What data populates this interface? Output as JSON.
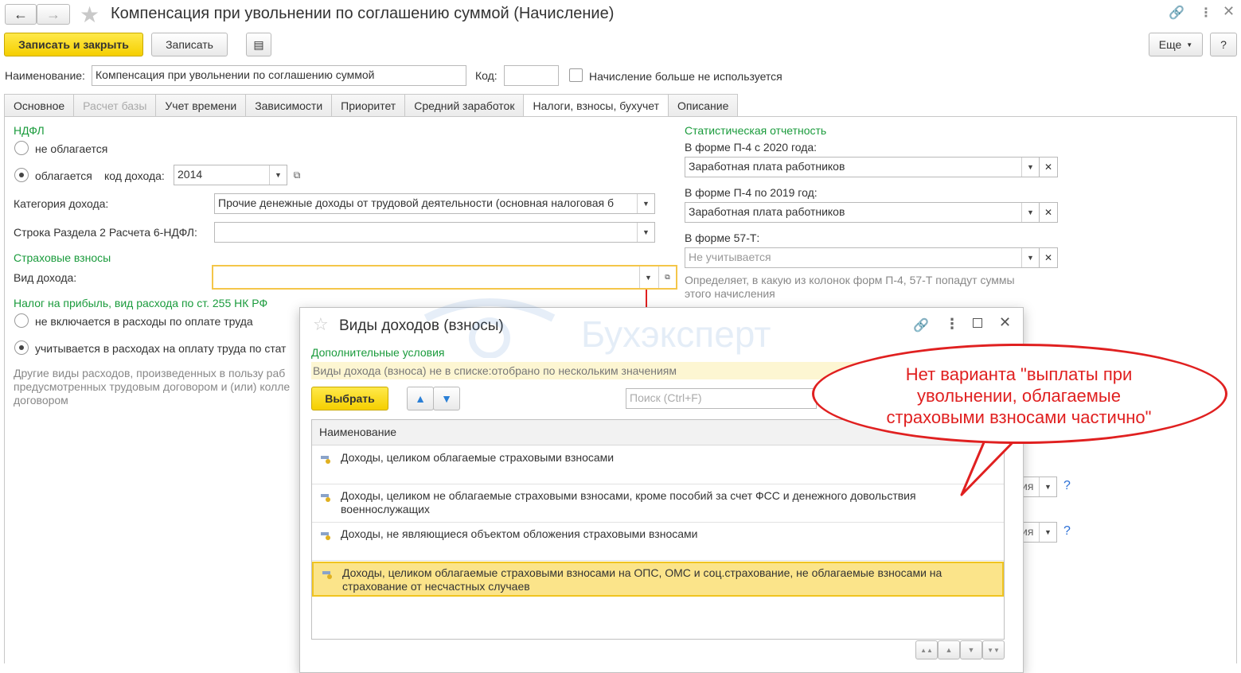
{
  "window": {
    "title": "Компенсация при увольнении по соглашению суммой (Начисление)"
  },
  "toolbar": {
    "save_close": "Записать и закрыть",
    "save": "Записать",
    "more": "Еще",
    "help": "?"
  },
  "form": {
    "name_label": "Наименование:",
    "name_value": "Компенсация при увольнении по соглашению суммой",
    "code_label": "Код:",
    "code_value": "",
    "unused_label": "Начисление больше не используется"
  },
  "tabs": [
    {
      "label": "Основное",
      "state": "normal"
    },
    {
      "label": "Расчет базы",
      "state": "disabled"
    },
    {
      "label": "Учет времени",
      "state": "normal"
    },
    {
      "label": "Зависимости",
      "state": "normal"
    },
    {
      "label": "Приоритет",
      "state": "normal"
    },
    {
      "label": "Средний заработок",
      "state": "normal"
    },
    {
      "label": "Налоги, взносы, бухучет",
      "state": "active"
    },
    {
      "label": "Описание",
      "state": "normal"
    }
  ],
  "ndfl": {
    "section": "НДФЛ",
    "not_taxed": "не облагается",
    "taxed": "облагается",
    "income_code_label": "код дохода:",
    "income_code_value": "2014",
    "income_category_label": "Категория дохода:",
    "income_category_value": "Прочие денежные доходы от трудовой деятельности (основная налоговая б",
    "row_6ndfl_label": "Строка Раздела 2 Расчета 6-НДФЛ:",
    "row_6ndfl_value": ""
  },
  "insurance": {
    "section": "Страховые взносы",
    "income_type_label": "Вид дохода:",
    "income_type_value": ""
  },
  "profit_tax": {
    "section": "Налог на прибыль, вид расхода по ст. 255 НК РФ",
    "opt_not_included": "не включается в расходы по оплате труда",
    "opt_included": "учитывается в расходах на оплату труда по стат",
    "note_line1": "Другие виды расходов, произведенных в пользу раб",
    "note_line2": "предусмотренных трудовым договором и (или) колле",
    "note_line3": "договором"
  },
  "stats": {
    "section": "Статистическая отчетность",
    "p4_2020_label": "В форме П-4 с 2020 года:",
    "p4_2020_value": "Заработная плата работников",
    "p4_2019_label": "В форме П-4 по 2019 год:",
    "p4_2019_value": "Заработная плата работников",
    "f57t_label": "В форме 57-Т:",
    "f57t_value": "Не учитывается",
    "note_line1": "Определяет, в какую из колонок форм П-4, 57-Т попадут суммы",
    "note_line2": "этого начисления",
    "hidden_dd1": "ия",
    "hidden_dd2": "ия",
    "q1": "?",
    "q2": "?"
  },
  "popup": {
    "title": "Виды доходов (взносы)",
    "extra_conditions": "Дополнительные условия",
    "filter_text": "Виды дохода (взноса) не в списке:отобрано по нескольким значениям",
    "select_btn": "Выбрать",
    "search_placeholder": "Поиск (Ctrl+F)",
    "column_header": "Наименование",
    "rows": [
      {
        "line1": "Доходы, целиком облагаемые страховыми взносами",
        "line2": ""
      },
      {
        "line1": "Доходы, целиком не облагаемые страховыми взносами, кроме пособий за счет ФСС и денежного довольствия",
        "line2": "военнослужащих"
      },
      {
        "line1": "Доходы, не являющиеся объектом обложения страховыми взносами",
        "line2": ""
      },
      {
        "line1": "Доходы, целиком облагаемые страховыми взносами на ОПС, ОМС и соц.страхование, не облагаемые взносами на",
        "line2": "страхование от несчастных случаев"
      }
    ]
  },
  "watermark": "Бухэксперт",
  "callout": {
    "line1": "Нет варианта \"выплаты при",
    "line2": "увольнении, облагаемые",
    "line3": "страховыми взносами частично\""
  },
  "colors": {
    "accent_yellow": "#f5cf00",
    "section_green": "#1a9b3c",
    "callout_red": "#e02020",
    "selected_row": "#fbe48a"
  }
}
